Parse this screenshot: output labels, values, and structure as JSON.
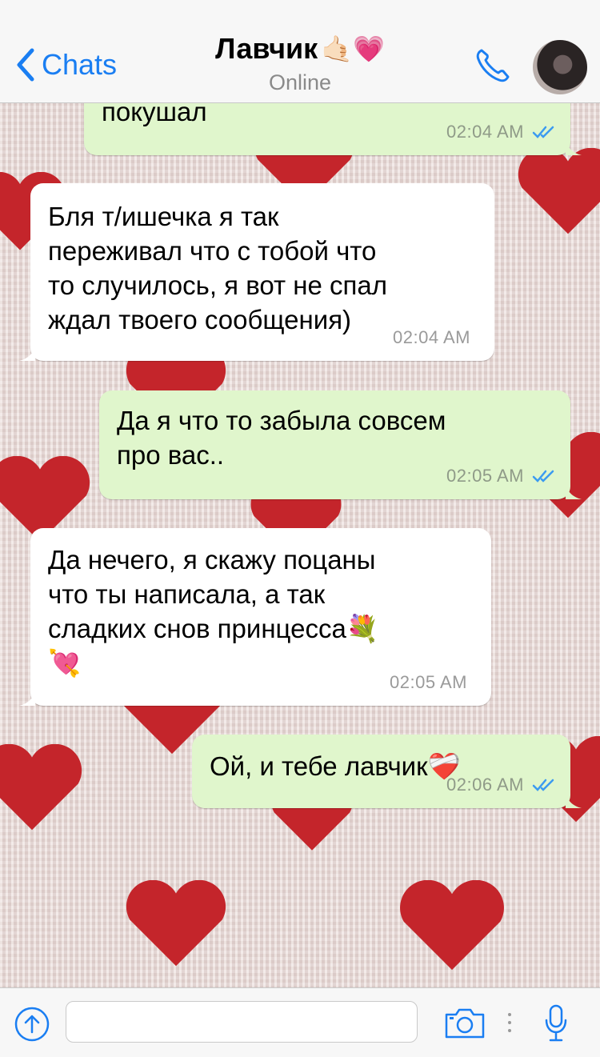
{
  "header": {
    "back_label": "Chats",
    "title": "Лавчик",
    "title_emoji": "🤙🏻💗",
    "status": "Online"
  },
  "messages": [
    {
      "direction": "out",
      "text": "покушал",
      "time": "02:04 AM",
      "read": true
    },
    {
      "direction": "in",
      "text": "Бля т/ишечка я так\nпереживал что с тобой что\nто случилось, я вот не спал\nждал твоего сообщения)",
      "time": "02:04 AM"
    },
    {
      "direction": "out",
      "text": "Да я что то забыла совсем\nпро вас..",
      "time": "02:05 AM",
      "read": true
    },
    {
      "direction": "in",
      "text": "Да нечего, я скажу поцаны\nчто ты написала,  а так\nсладких снов принцесса💐\n💘",
      "time": "02:05 AM"
    },
    {
      "direction": "out",
      "text": "Ой, и тебе лавчик❤️‍🩹",
      "time": "02:06 AM",
      "read": true
    }
  ],
  "input": {
    "value": "",
    "placeholder": ""
  },
  "icons": {
    "back": "chevron-left-icon",
    "call": "phone-icon",
    "attach": "upload-icon",
    "camera": "camera-icon",
    "mic": "microphone-icon",
    "read": "double-check-icon"
  },
  "colors": {
    "accent": "#1a7ef2",
    "outgoing_bubble": "#e0f6cc",
    "incoming_bubble": "#ffffff",
    "heart": "#c4252b",
    "read_check": "#3c9bf0"
  }
}
